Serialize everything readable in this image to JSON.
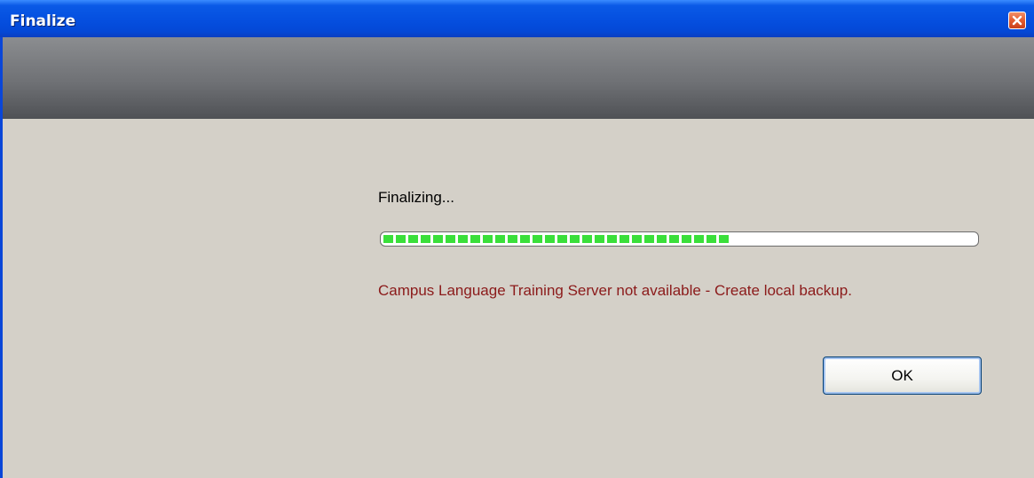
{
  "window": {
    "title": "Finalize"
  },
  "titlebar": {
    "close_icon": "close-icon"
  },
  "dialog": {
    "status_label": "Finalizing...",
    "progress_fraction": 0.6,
    "message": "Campus Language Training Server not available - Create local backup.",
    "ok_label": "OK"
  },
  "colors": {
    "titlebar": "#0550e0",
    "progress": "#3adf3a",
    "error_text": "#8b1a1a",
    "background": "#d4d0c8"
  }
}
